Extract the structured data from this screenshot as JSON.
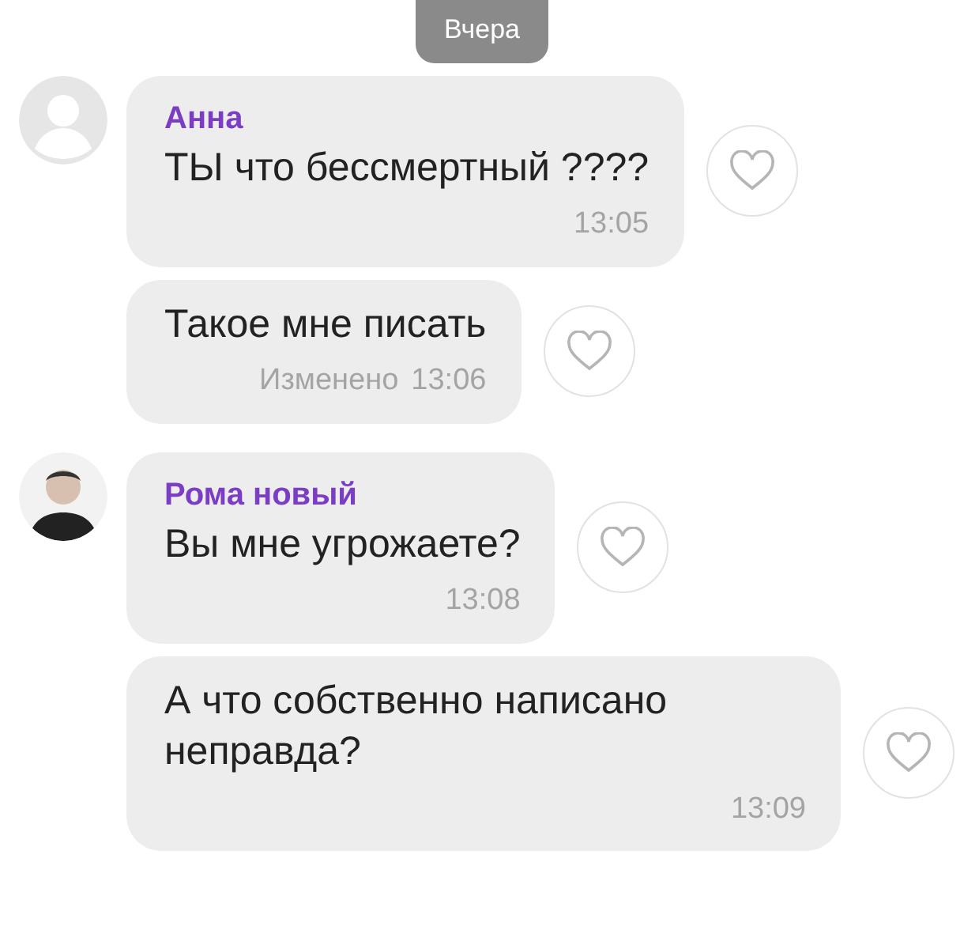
{
  "date_label": "Вчера",
  "groups": [
    {
      "sender": "Анна",
      "avatar": {
        "kind": "placeholder"
      },
      "messages": [
        {
          "text": "ТЫ что бессмертный ????",
          "time": "13:05"
        },
        {
          "text": "Такое мне писать",
          "status": "Изменено",
          "time": "13:06"
        }
      ]
    },
    {
      "sender": "Рома новый",
      "avatar": {
        "kind": "photo"
      },
      "messages": [
        {
          "text": "Вы мне угрожаете?",
          "time": "13:08"
        },
        {
          "text": "А что собственно написано неправда?",
          "time": "13:09"
        }
      ]
    }
  ]
}
